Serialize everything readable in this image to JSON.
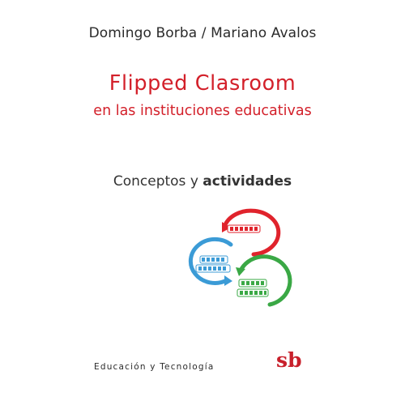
{
  "cover": {
    "authors": "Domingo Borba / Mariano Avalos",
    "title": "Flipped Clasroom",
    "subtitle": "en las instituciones educativas",
    "concepts_regular": "Conceptos y ",
    "concepts_bold": "actividades",
    "series": "Educación y Tecnología",
    "publisher_logo": "sb"
  },
  "diagram": {
    "colors": {
      "red": "#e0232c",
      "blue": "#3b9bd6",
      "green": "#3aa845"
    },
    "icons": [
      "red-cycle-arrow-icon",
      "blue-cycle-arrow-icon",
      "green-cycle-arrow-icon"
    ]
  },
  "colors": {
    "title": "#d3202a",
    "text": "#2b2b2b"
  }
}
